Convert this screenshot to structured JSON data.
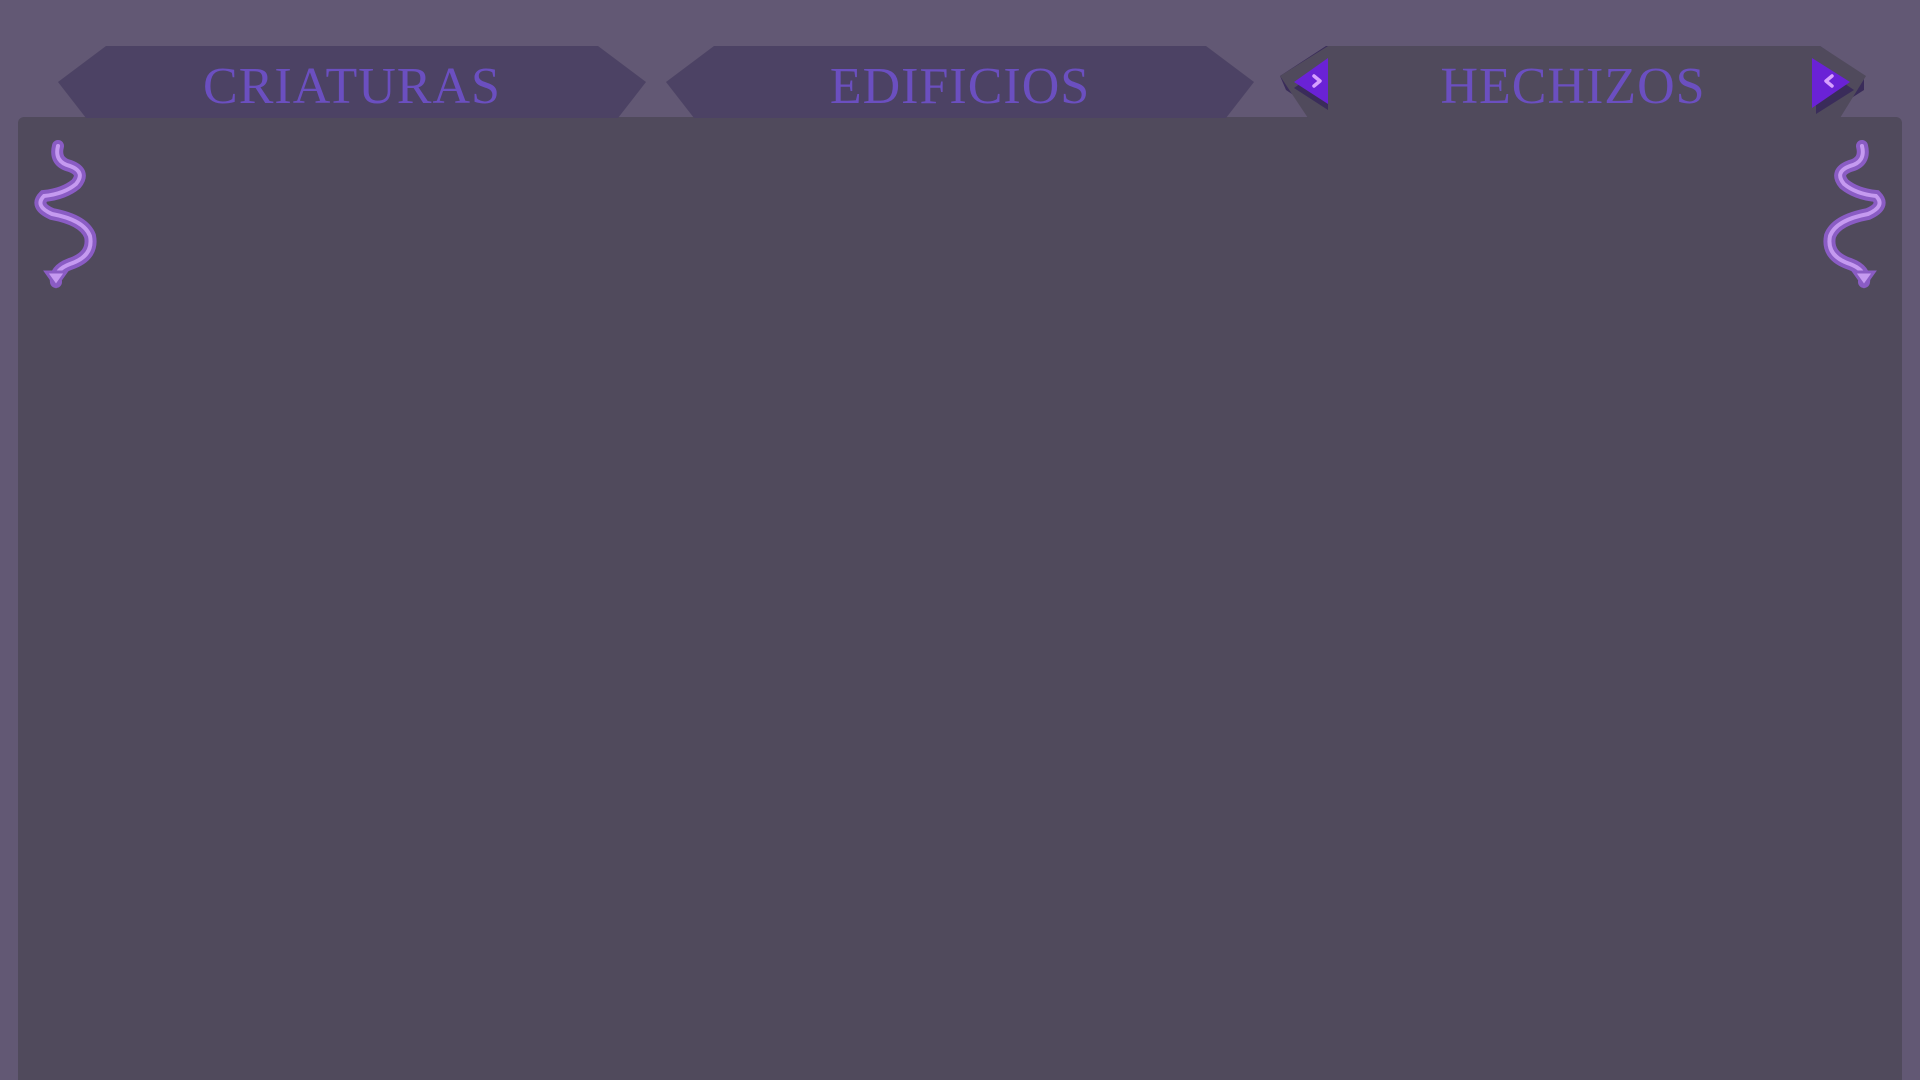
{
  "tabs": [
    {
      "id": "criaturas",
      "label": "CRIATURAS",
      "active": false
    },
    {
      "id": "edificios",
      "label": "EDIFICIOS",
      "active": false
    },
    {
      "id": "hechizos",
      "label": "HECHIZOS",
      "active": true
    }
  ],
  "colors": {
    "background": "#625874",
    "panel": "#504a5c",
    "tab_inactive": "#4c4264",
    "tab_active": "#504a5c",
    "tab_text": "#6b4fc0",
    "arrow_fill": "#6a22d6",
    "arrow_shadow": "#3a2c5a",
    "arrow_glyph": "#d6a0ff",
    "swirl_outer": "#8a5cc4",
    "swirl_inner": "#c59af0"
  },
  "icons": {
    "prev": "left-arrow-icon",
    "next": "right-arrow-icon",
    "ornament": "swirl-ornament-icon"
  }
}
